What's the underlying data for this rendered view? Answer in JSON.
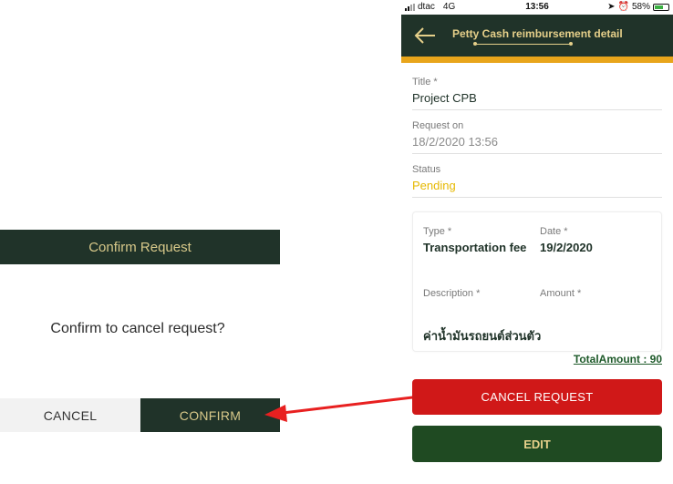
{
  "dialog": {
    "title": "Confirm Request",
    "message": "Confirm to cancel request?",
    "cancel_label": "CANCEL",
    "confirm_label": "CONFIRM"
  },
  "status_bar": {
    "carrier": "dtac",
    "network": "4G",
    "time": "13:56",
    "battery": "58%"
  },
  "header": {
    "title": "Petty Cash reimbursement detail",
    "back_icon": "arrow-left-icon"
  },
  "fields": {
    "title_label": "Title *",
    "title_value": "Project CPB",
    "request_on_label": "Request on",
    "request_on_value": "18/2/2020 13:56",
    "status_label": "Status",
    "status_value": "Pending"
  },
  "item": {
    "type_label": "Type *",
    "type_value": "Transportation fee",
    "date_label": "Date *",
    "date_value": "19/2/2020",
    "description_label": "Description *",
    "amount_label": "Amount *",
    "description_value": "ค่าน้ำมันรถยนต์ส่วนตัว"
  },
  "total": "TotalAmount : 90",
  "actions": {
    "cancel_request": "CANCEL REQUEST",
    "edit": "EDIT"
  },
  "colors": {
    "dark_green": "#203329",
    "gold": "#d8c98a",
    "orange": "#e8a51b",
    "red": "#d01818",
    "pending": "#e6b800",
    "edit_green": "#1f4a22"
  }
}
